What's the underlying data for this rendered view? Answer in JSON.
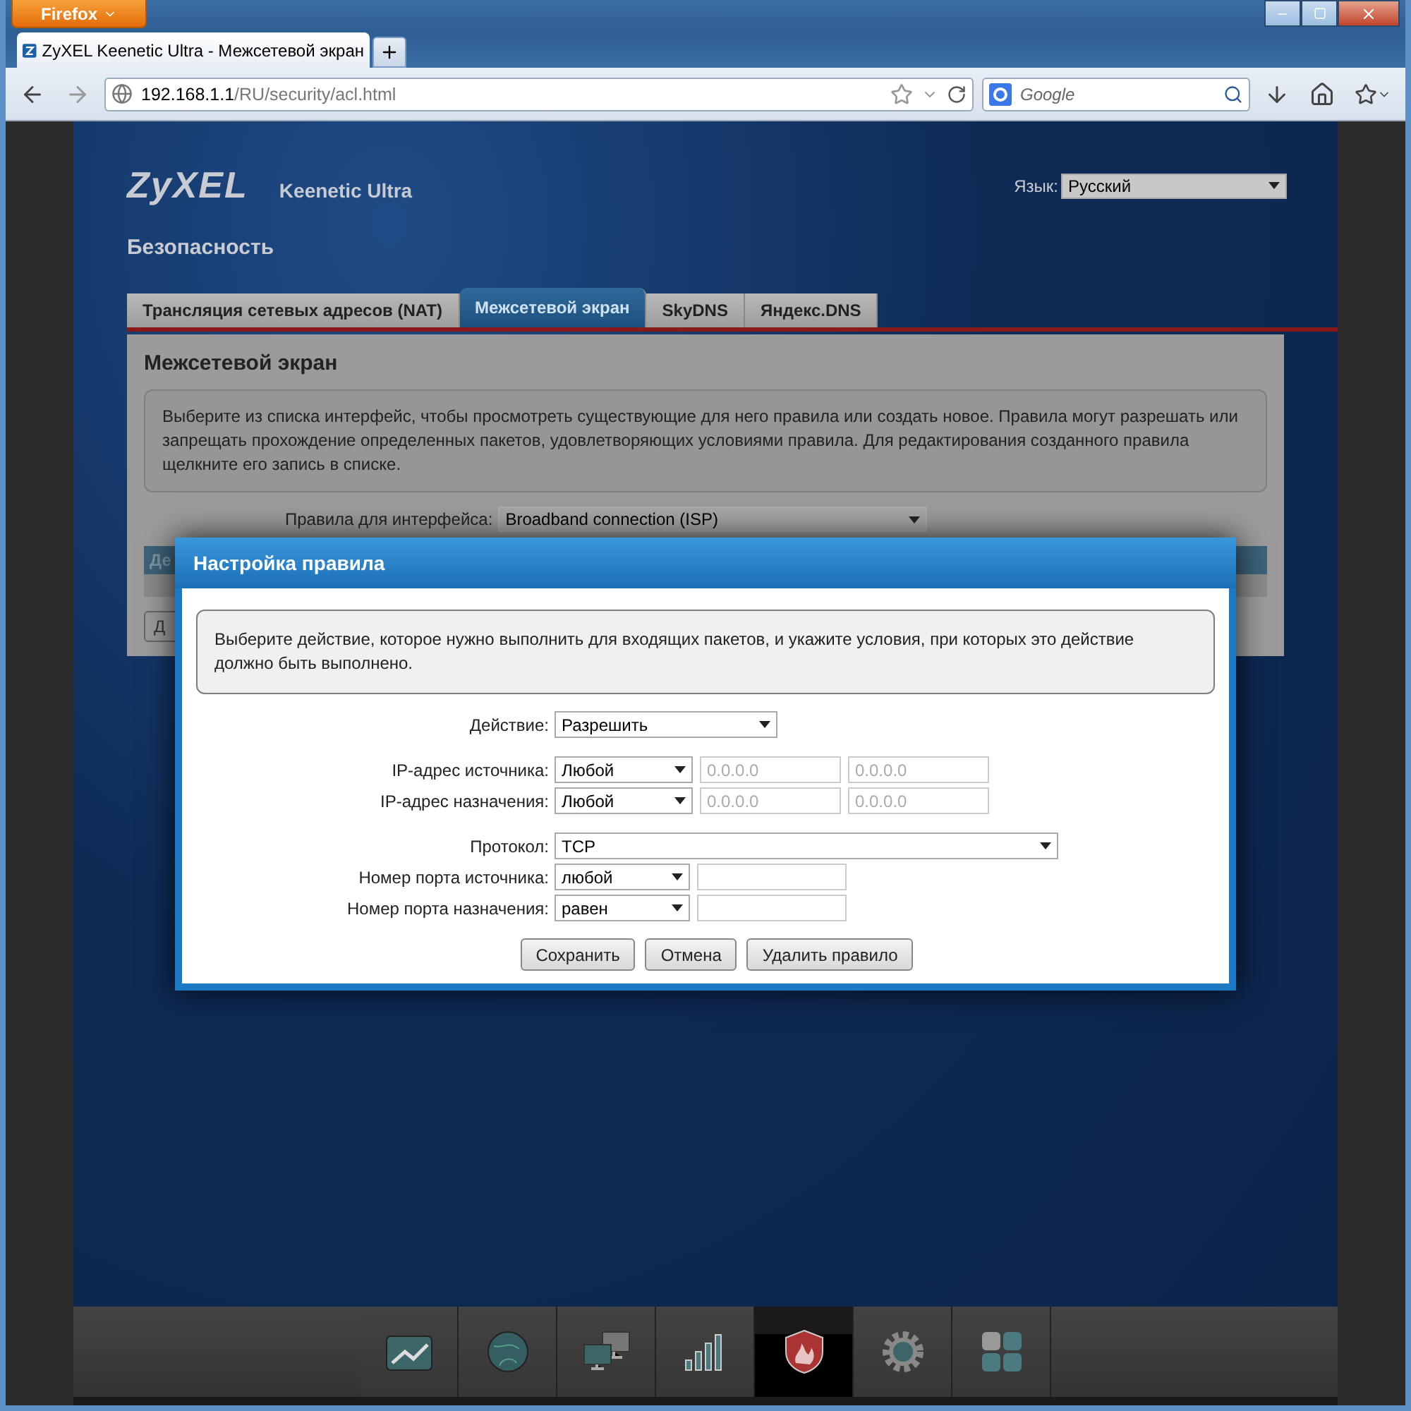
{
  "browser": {
    "menu_button": "Firefox",
    "tab_title": "ZyXEL Keenetic Ultra - Межсетевой экран",
    "url_host": "192.168.1.1",
    "url_path": "/RU/security/acl.html",
    "search_placeholder": "Google"
  },
  "header": {
    "logo": "ZyXEL",
    "product": "Keenetic Ultra",
    "language_label": "Язык:",
    "language": "Русский",
    "section_title": "Безопасность"
  },
  "tabs": [
    {
      "label": "Трансляция сетевых адресов (NAT)",
      "selected": false
    },
    {
      "label": "Межсетевой экран",
      "selected": true
    },
    {
      "label": "SkyDNS",
      "selected": false
    },
    {
      "label": "Яндекс.DNS",
      "selected": false
    }
  ],
  "panel": {
    "title": "Межсетевой экран",
    "info": "Выберите из списка интерфейс, чтобы просмотреть существующие для него правила или создать новое. Правила могут разрешать или запрещать прохождение определенных пакетов, удовлетворяющих условиями правила. Для редактирования созданного правила щелкните его запись в списке.",
    "interface_label": "Правила для интерфейса:",
    "interface": "Broadband connection (ISP)",
    "table_header": "Де",
    "button": "Д"
  },
  "dialog": {
    "title": "Настройка правила",
    "info": "Выберите действие, которое нужно выполнить для входящих пакетов, и укажите условия, при которых это действие должно быть выполнено.",
    "field_groups": [
      [
        {
          "kind": "select",
          "label": "Действие:",
          "value": "Разрешить"
        }
      ],
      [
        {
          "kind": "address",
          "label": "IP-адрес источника:",
          "value": "Любой",
          "inputs": [
            "0.0.0.0",
            "0.0.0.0"
          ]
        },
        {
          "kind": "address",
          "label": "IP-адрес назначения:",
          "value": "Любой",
          "inputs": [
            "0.0.0.0",
            "0.0.0.0"
          ]
        }
      ],
      [
        {
          "kind": "wide",
          "label": "Протокол:",
          "value": "TCP"
        },
        {
          "kind": "port",
          "label": "Номер порта источника:",
          "value": "любой"
        },
        {
          "kind": "port",
          "label": "Номер порта назначения:",
          "value": "равен"
        }
      ]
    ],
    "buttons": [
      "Сохранить",
      "Отмена",
      "Удалить правило"
    ]
  },
  "nav_bar": [
    {
      "kind": "chart",
      "selected": false
    },
    {
      "kind": "globe",
      "selected": false
    },
    {
      "kind": "computers",
      "selected": false
    },
    {
      "kind": "signal",
      "selected": false
    },
    {
      "kind": "shield",
      "selected": true
    },
    {
      "kind": "gear",
      "selected": false
    },
    {
      "kind": "apps",
      "selected": false
    }
  ]
}
